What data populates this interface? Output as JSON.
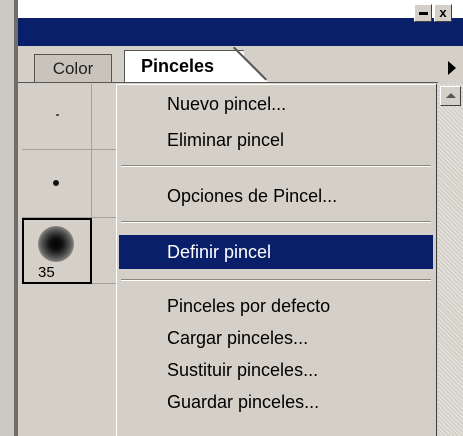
{
  "window": {
    "minimize_icon": "minimize-icon",
    "close_label": "x"
  },
  "tabs": [
    {
      "label": "Color"
    },
    {
      "label": "Pinceles"
    }
  ],
  "brushes": {
    "selected_size": "35"
  },
  "menu": {
    "items": [
      {
        "label": "Nuevo pincel..."
      },
      {
        "label": "Eliminar pincel"
      },
      {
        "label": "Opciones de Pincel..."
      },
      {
        "label": "Definir pincel"
      },
      {
        "label": "Pinceles por defecto"
      },
      {
        "label": "Cargar pinceles..."
      },
      {
        "label": "Sustituir pinceles..."
      },
      {
        "label": "Guardar pinceles..."
      }
    ],
    "selected_index": 3
  },
  "colors": {
    "titlebar": "#0a1f6a",
    "panel": "#d4d0c8",
    "highlight": "#0a1f6a"
  }
}
